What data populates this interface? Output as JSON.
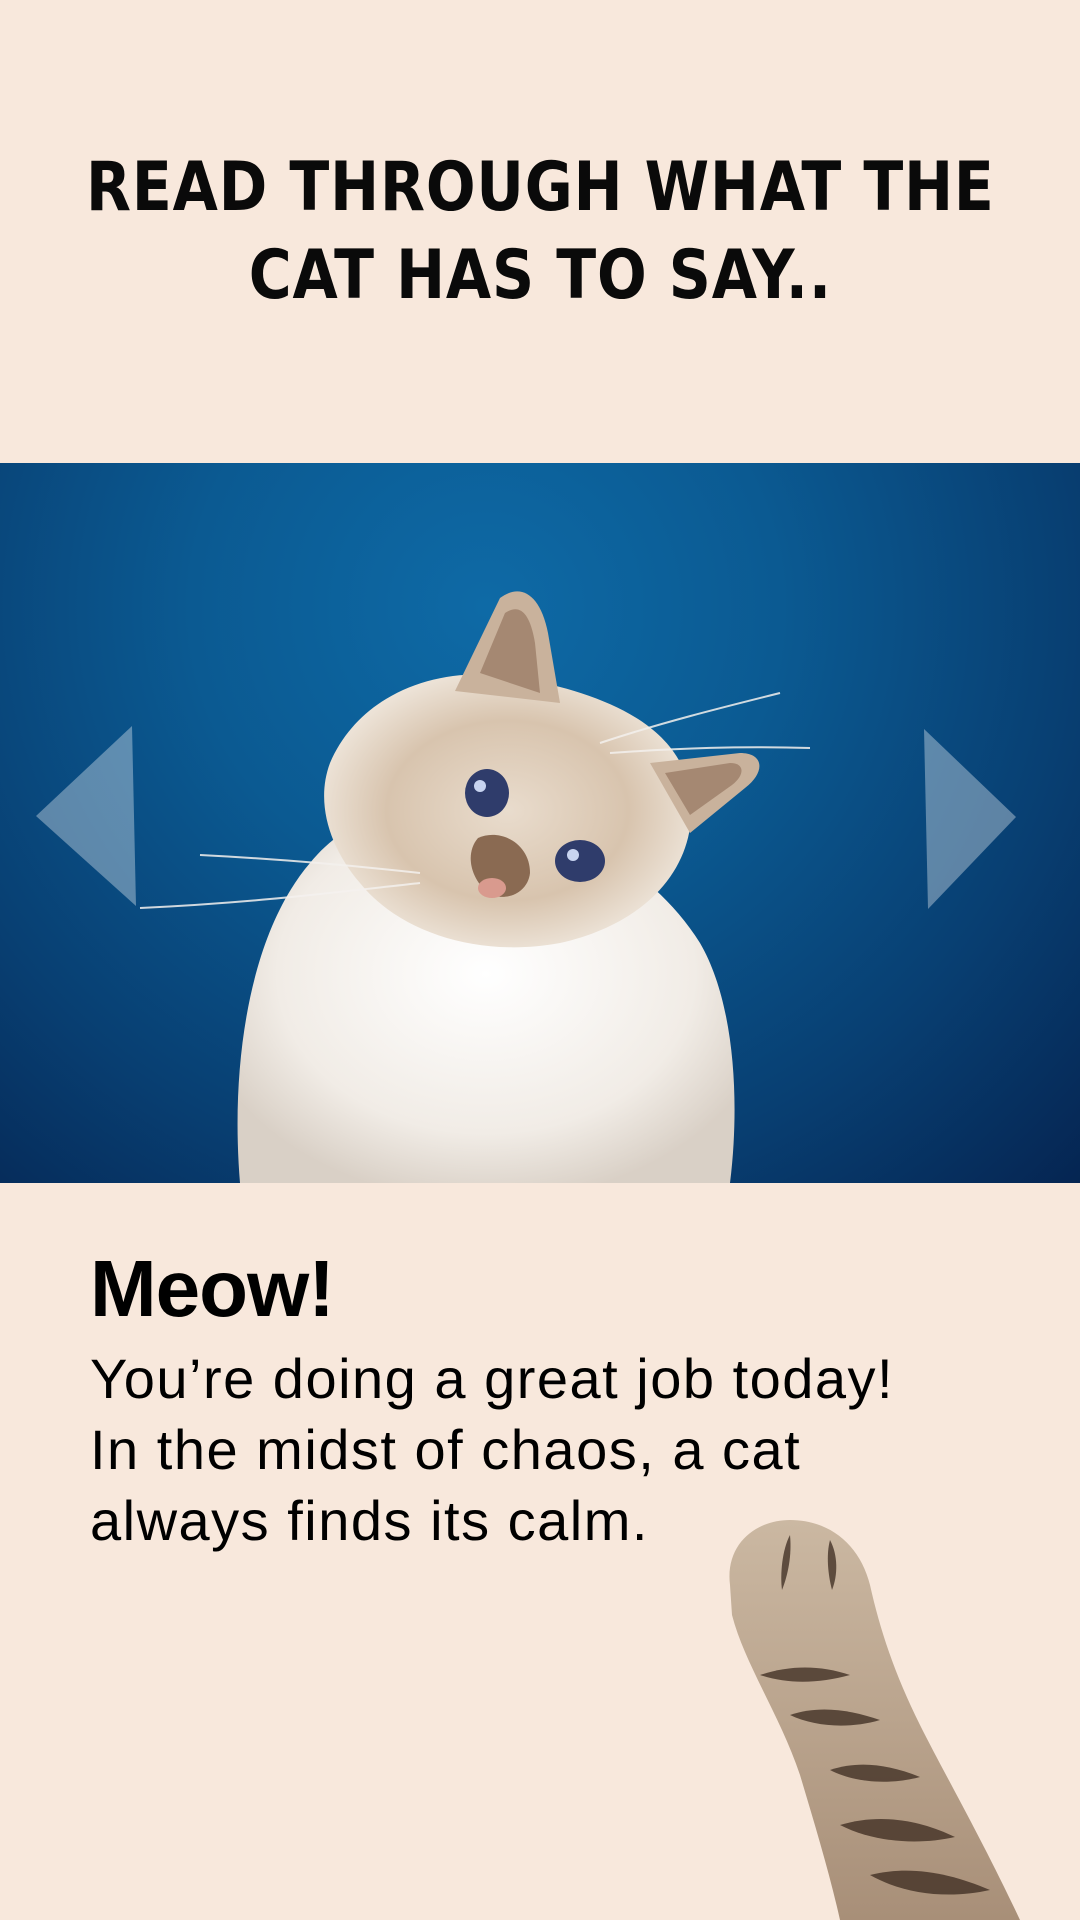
{
  "header": {
    "line1": "READ THROUGH WHAT THE",
    "line2": "CAT HAS TO SAY.."
  },
  "hero": {
    "image": "cat-photo",
    "background_color": "#0b5a92",
    "prev_icon": "triangle-left-icon",
    "next_icon": "triangle-right-icon"
  },
  "card": {
    "title": "Meow!",
    "line1": "You’re doing a great job today!",
    "line2": "In the midst of chaos, a cat",
    "line3": "always finds its calm."
  },
  "decoration": {
    "paw": "cat-paw-image"
  },
  "colors": {
    "page_background": "#f8e8dc",
    "text": "#000000"
  }
}
